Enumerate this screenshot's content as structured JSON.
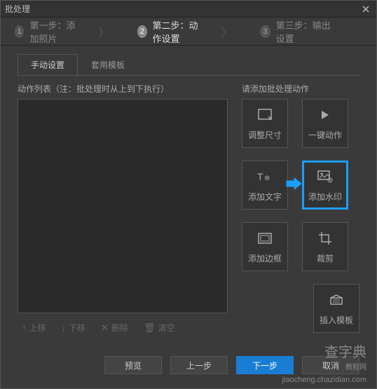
{
  "window": {
    "title": "批处理"
  },
  "steps": [
    {
      "num": "1",
      "label": "第一步：添加照片"
    },
    {
      "num": "2",
      "label": "第二步：动作设置"
    },
    {
      "num": "3",
      "label": "第三步：输出设置"
    }
  ],
  "tabs": {
    "manual": "手动设置",
    "template": "套用模板"
  },
  "panels": {
    "actionListLabel": "动作列表（注：批处理时从上到下执行）",
    "addActionLabel": "请添加批处理动作"
  },
  "listButtons": {
    "up": "上移",
    "down": "下移",
    "delete": "删除",
    "clear": "清空"
  },
  "actions": {
    "resize": "调整尺寸",
    "oneClick": "一键动作",
    "addText": "添加文字",
    "addWatermark": "添加水印",
    "addBorder": "添加边框",
    "crop": "裁剪",
    "insertTemplate": "插入模板"
  },
  "footer": {
    "preview": "预览",
    "prev": "上一步",
    "next": "下一步",
    "cancel": "取消"
  },
  "watermark": {
    "main": "查字典",
    "sub": "教程网",
    "url": "jiaocheng.chazidian.com"
  }
}
